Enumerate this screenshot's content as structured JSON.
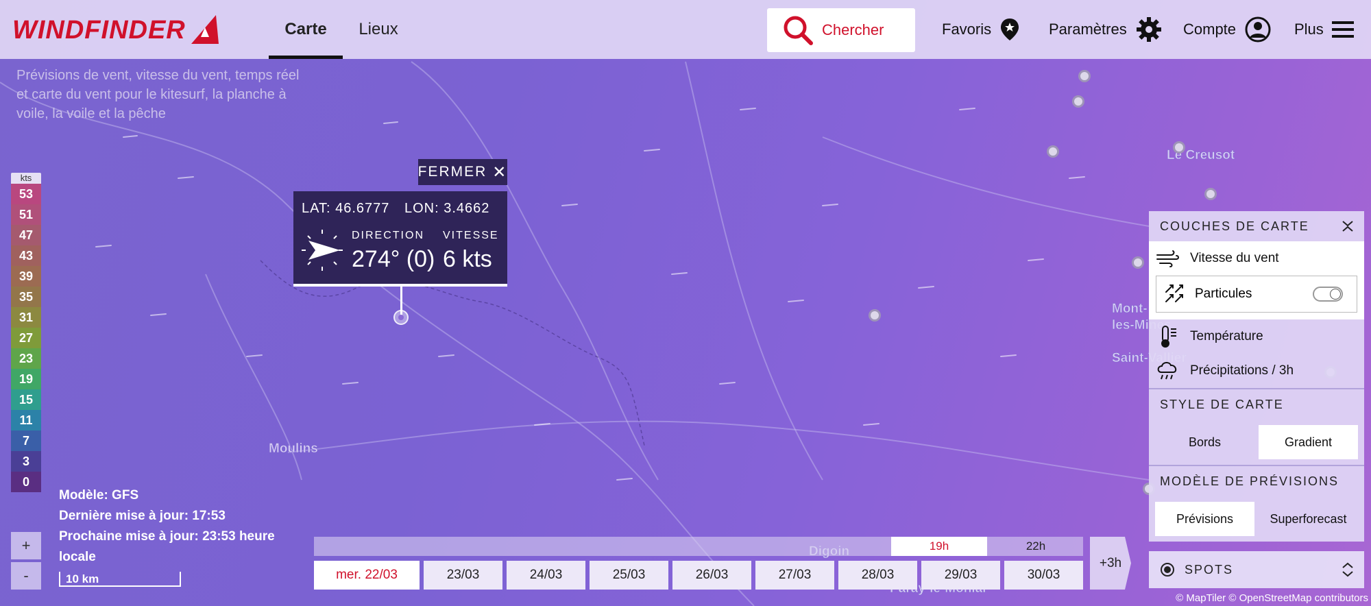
{
  "header": {
    "logo": "WINDFINDER",
    "tabs": [
      {
        "label": "Carte",
        "active": true
      },
      {
        "label": "Lieux",
        "active": false
      }
    ],
    "search_label": "Chercher",
    "favoris": "Favoris",
    "parametres": "Paramètres",
    "compte": "Compte",
    "plus": "Plus"
  },
  "tagline": "Prévisions de vent, vitesse du vent, temps réel et carte du vent pour le kitesurf, la planche à voile, la voile et la pêche",
  "legend": {
    "unit": "kts",
    "values": [
      "53",
      "51",
      "47",
      "43",
      "39",
      "35",
      "31",
      "27",
      "23",
      "19",
      "15",
      "11",
      "7",
      "3",
      "0"
    ],
    "colors": [
      "#b9477f",
      "#b0507a",
      "#a55a6e",
      "#a0615e",
      "#9c6b52",
      "#93764a",
      "#8c8940",
      "#7f9b3a",
      "#5fa54a",
      "#40a766",
      "#2f9e8e",
      "#2c82a8",
      "#3a5fa8",
      "#4a3f96",
      "#5a2e82"
    ]
  },
  "popup": {
    "close_label": "FERMER",
    "lat": "LAT: 46.6777",
    "lon": "LON: 3.4662",
    "direction_label": "DIRECTION",
    "direction_value": "274° (0)",
    "speed_label": "VITESSE",
    "speed_value": "6 kts"
  },
  "model_info": {
    "model": "Modèle: GFS",
    "last_update": "Dernière mise à jour: 17:53",
    "next_update": "Prochaine mise à jour: 23:53 heure locale"
  },
  "zoom": {
    "in": "+",
    "out": "-"
  },
  "scale_label": "10 km",
  "timeline": {
    "hours": [
      {
        "label": "19h",
        "active": true
      },
      {
        "label": "22h",
        "active": false
      }
    ],
    "dates": [
      {
        "label": "mer. 22/03",
        "active": true
      },
      {
        "label": "23/03"
      },
      {
        "label": "24/03"
      },
      {
        "label": "25/03"
      },
      {
        "label": "26/03"
      },
      {
        "label": "27/03"
      },
      {
        "label": "28/03"
      },
      {
        "label": "29/03"
      },
      {
        "label": "30/03"
      }
    ],
    "step_label": "+3h"
  },
  "panel": {
    "layers_title": "COUCHES DE CARTE",
    "layers": [
      {
        "label": "Vitesse du vent",
        "icon": "wind-icon"
      },
      {
        "label": "Particules",
        "icon": "particles-icon",
        "toggle": true
      },
      {
        "label": "Température",
        "icon": "thermometer-icon"
      },
      {
        "label": "Précipitations / 3h",
        "icon": "rain-cloud-icon"
      }
    ],
    "style_title": "STYLE DE CARTE",
    "style_options": [
      {
        "label": "Bords",
        "selected": false
      },
      {
        "label": "Gradient",
        "selected": true
      }
    ],
    "model_title": "MODÈLE DE PRÉVISIONS",
    "model_options": [
      {
        "label": "Prévisions",
        "selected": true
      },
      {
        "label": "Superforecast",
        "selected": false
      }
    ],
    "spots_label": "SPOTS"
  },
  "towns": [
    "Le Creusot",
    "Mont-",
    "les-Mines",
    "Saint-Vallier",
    "Moulins",
    "Digoin",
    "Paray-le-Monial"
  ],
  "credits": "© MapTiler © OpenStreetMap contributors"
}
